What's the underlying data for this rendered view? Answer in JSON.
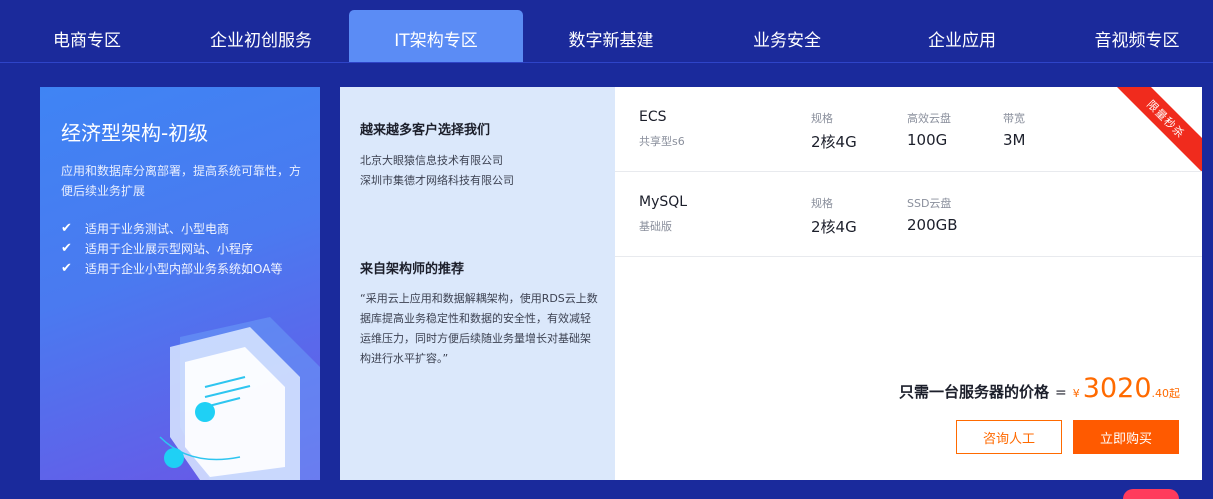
{
  "tabs": [
    {
      "label": "电商专区"
    },
    {
      "label": "企业初创服务"
    },
    {
      "label": "IT架构专区"
    },
    {
      "label": "数字新基建"
    },
    {
      "label": "业务安全"
    },
    {
      "label": "企业应用"
    },
    {
      "label": "音视频专区"
    }
  ],
  "active_tab": "IT架构专区",
  "left_card": {
    "title": "经济型架构-初级",
    "desc": "应用和数据库分离部署，提高系统可靠性，方便后续业务扩展",
    "features": [
      "适用于业务测试、小型电商",
      "适用于企业展示型网站、小程序",
      "适用于企业小型内部业务系统如OA等"
    ]
  },
  "mid_card": {
    "customers_heading": "越来越多客户选择我们",
    "customers": [
      "北京大眼猿信息技术有限公司",
      "深圳市集德才网络科技有限公司"
    ],
    "recommend_heading": "来自架构师的推荐",
    "recommend_text": "“采用云上应用和数据解耦架构，使用RDS云上数据库提高业务稳定性和数据的安全性，有效减轻运维压力，同时方便后续随业务量增长对基础架构进行水平扩容。”"
  },
  "products": [
    {
      "name": "ECS",
      "sub": "共享型s6",
      "specs": [
        {
          "label": "规格",
          "value": "2核4G"
        },
        {
          "label": "高效云盘",
          "value": "100G"
        },
        {
          "label": "带宽",
          "value": "3M"
        }
      ]
    },
    {
      "name": "MySQL",
      "sub": "基础版",
      "specs": [
        {
          "label": "规格",
          "value": "2核4G"
        },
        {
          "label": "SSD云盘",
          "value": "200GB"
        }
      ]
    }
  ],
  "ribbon": "限量秒杀",
  "price": {
    "label": "只需一台服务器的价格",
    "equals": "=",
    "currency": "¥",
    "integer": "3020",
    "decimal": ".40",
    "suffix": "起"
  },
  "buttons": {
    "consult": "咨询人工",
    "buy": "立即购买"
  },
  "colors": {
    "page_bg": "#1a2a9c",
    "active_tab": "#5b8cf5",
    "accent_orange": "#ff6a00",
    "ribbon_red": "#f02b1d",
    "mid_card_bg": "#dbe8fb"
  }
}
